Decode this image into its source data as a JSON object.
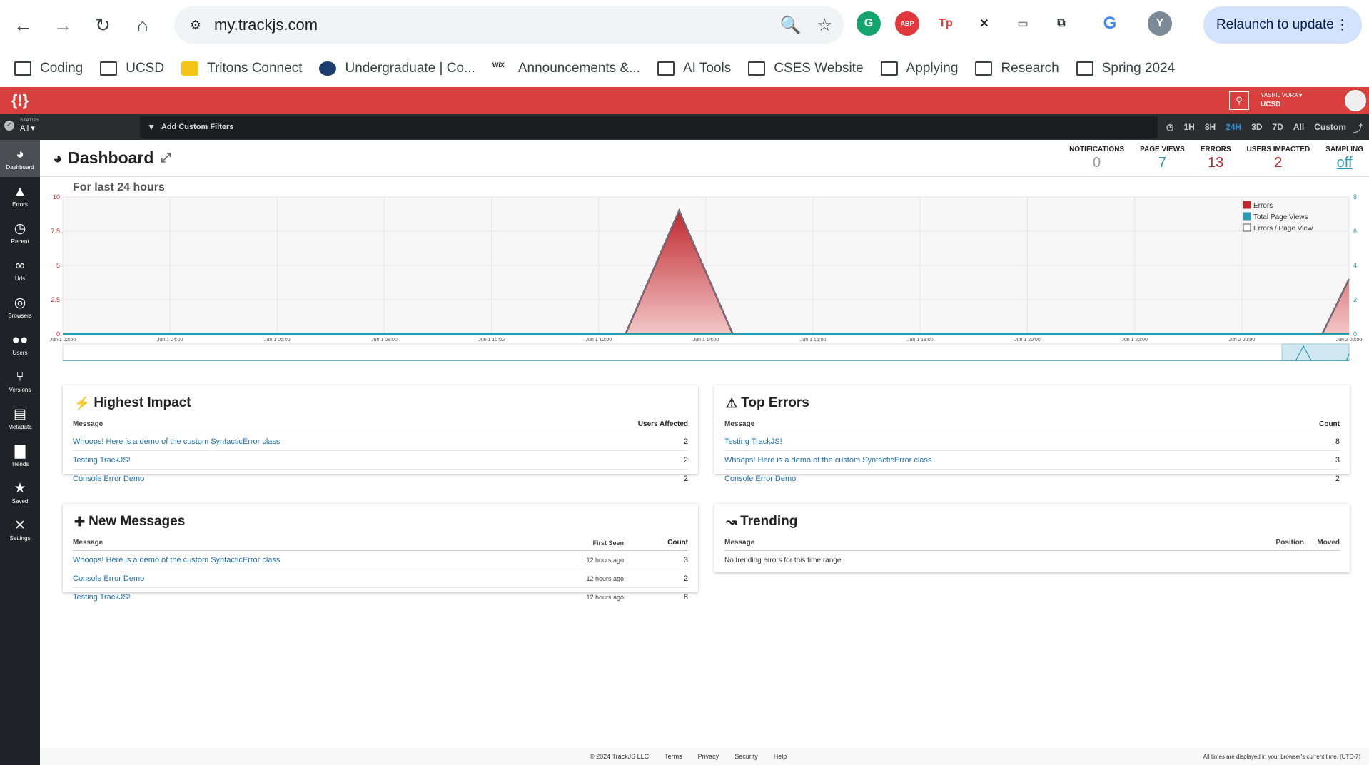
{
  "browser": {
    "url": "my.trackjs.com",
    "relaunch_label": "Relaunch to update",
    "profile_initial": "Y",
    "extensions": [
      "G",
      "ABP",
      "Tp",
      "✕",
      "▭",
      "⧉",
      "G"
    ],
    "bookmarks": [
      {
        "label": "Coding",
        "icon": "folder-icon"
      },
      {
        "label": "UCSD",
        "icon": "folder-icon"
      },
      {
        "label": "Tritons Connect",
        "icon": "tritons-favicon"
      },
      {
        "label": "Undergraduate | Co...",
        "icon": "cse-favicon"
      },
      {
        "label": "Announcements &...",
        "icon": "wix-favicon"
      },
      {
        "label": "AI Tools",
        "icon": "folder-icon"
      },
      {
        "label": "CSES Website",
        "icon": "folder-icon"
      },
      {
        "label": "Applying",
        "icon": "folder-icon"
      },
      {
        "label": "Research",
        "icon": "folder-icon"
      },
      {
        "label": "Spring 2024",
        "icon": "folder-icon"
      }
    ]
  },
  "topbar": {
    "user_name": "YASHIL VORA",
    "org": "UCSD"
  },
  "filterbar": {
    "status_label": "STATUS",
    "status_value": "All",
    "filter_placeholder": "Add Custom Filters",
    "ranges": [
      "1H",
      "8H",
      "24H",
      "3D",
      "7D",
      "All",
      "Custom"
    ],
    "active_range": "24H"
  },
  "sidebar": {
    "items": [
      {
        "label": "Dashboard",
        "icon": "dashboard-icon"
      },
      {
        "label": "Errors",
        "icon": "warning-icon"
      },
      {
        "label": "Recent",
        "icon": "clock-icon"
      },
      {
        "label": "Urls",
        "icon": "link-icon"
      },
      {
        "label": "Browsers",
        "icon": "browser-icon"
      },
      {
        "label": "Users",
        "icon": "users-icon"
      },
      {
        "label": "Versions",
        "icon": "branch-icon"
      },
      {
        "label": "Metadata",
        "icon": "database-icon"
      },
      {
        "label": "Trends",
        "icon": "bar-chart-icon"
      },
      {
        "label": "Saved",
        "icon": "star-icon"
      },
      {
        "label": "Settings",
        "icon": "tools-icon"
      }
    ]
  },
  "page": {
    "title": "Dashboard",
    "subtitle": "For last 24 hours",
    "stats": [
      {
        "label": "NOTIFICATIONS",
        "value": "0",
        "color": "#999999"
      },
      {
        "label": "PAGE VIEWS",
        "value": "7",
        "color": "#2a9bb0"
      },
      {
        "label": "ERRORS",
        "value": "13",
        "color": "#c0282d"
      },
      {
        "label": "USERS IMPACTED",
        "value": "2",
        "color": "#c0282d"
      },
      {
        "label": "SAMPLING",
        "value": "off",
        "color": "#2a9bb0"
      }
    ]
  },
  "chart_data": {
    "type": "area",
    "title": "",
    "x_ticks": [
      "Jun 1 02:00",
      "Jun 1 04:00",
      "Jun 1 06:00",
      "Jun 1 08:00",
      "Jun 1 10:00",
      "Jun 1 12:00",
      "Jun 1 14:00",
      "Jun 1 16:00",
      "Jun 1 18:00",
      "Jun 1 20:00",
      "Jun 1 22:00",
      "Jun 2 00:00",
      "Jun 2 02:00"
    ],
    "y_left_ticks": [
      "0",
      "2.5",
      "5",
      "7.5",
      "10"
    ],
    "y_right_ticks": [
      "0",
      "2",
      "4",
      "6",
      "8"
    ],
    "ylim_left": [
      0,
      10
    ],
    "ylim_right": [
      0,
      8
    ],
    "legend": [
      "Errors",
      "Total Page Views",
      "Errors / Page View"
    ],
    "legend_position": "top-right",
    "series": [
      {
        "name": "Errors",
        "color": "#c0282d",
        "x_hours": [
          0,
          21,
          23,
          25,
          47,
          48
        ],
        "values": [
          0,
          0,
          9,
          0,
          0,
          4
        ]
      },
      {
        "name": "Total Page Views",
        "color": "#2a9bb0",
        "x_hours": [
          0,
          48
        ],
        "values": [
          0,
          0
        ]
      }
    ],
    "grid": true
  },
  "panels": {
    "highest_impact": {
      "title": "Highest Impact",
      "headers": [
        "Message",
        "Users Affected"
      ],
      "rows": [
        {
          "message": "Whoops! Here is a demo of the custom SyntacticError class",
          "value": "2"
        },
        {
          "message": "Testing TrackJS!",
          "value": "2"
        },
        {
          "message": "Console Error Demo",
          "value": "2"
        }
      ]
    },
    "top_errors": {
      "title": "Top Errors",
      "headers": [
        "Message",
        "Count"
      ],
      "rows": [
        {
          "message": "Testing TrackJS!",
          "value": "8"
        },
        {
          "message": "Whoops! Here is a demo of the custom SyntacticError class",
          "value": "3"
        },
        {
          "message": "Console Error Demo",
          "value": "2"
        }
      ]
    },
    "new_messages": {
      "title": "New Messages",
      "headers": [
        "Message",
        "First Seen",
        "Count"
      ],
      "rows": [
        {
          "message": "Whoops! Here is a demo of the custom SyntacticError class",
          "first_seen": "12 hours ago",
          "value": "3"
        },
        {
          "message": "Console Error Demo",
          "first_seen": "12 hours ago",
          "value": "2"
        },
        {
          "message": "Testing TrackJS!",
          "first_seen": "12 hours ago",
          "value": "8"
        }
      ]
    },
    "trending": {
      "title": "Trending",
      "headers": [
        "Message",
        "Position",
        "Moved"
      ],
      "empty": "No trending errors for this time range."
    }
  },
  "footer": {
    "copyright": "© 2024 TrackJS LLC",
    "links": [
      "Terms",
      "Privacy",
      "Security",
      "Help"
    ],
    "timezone": "All times are displayed in your browser's current time. (UTC-7)"
  }
}
